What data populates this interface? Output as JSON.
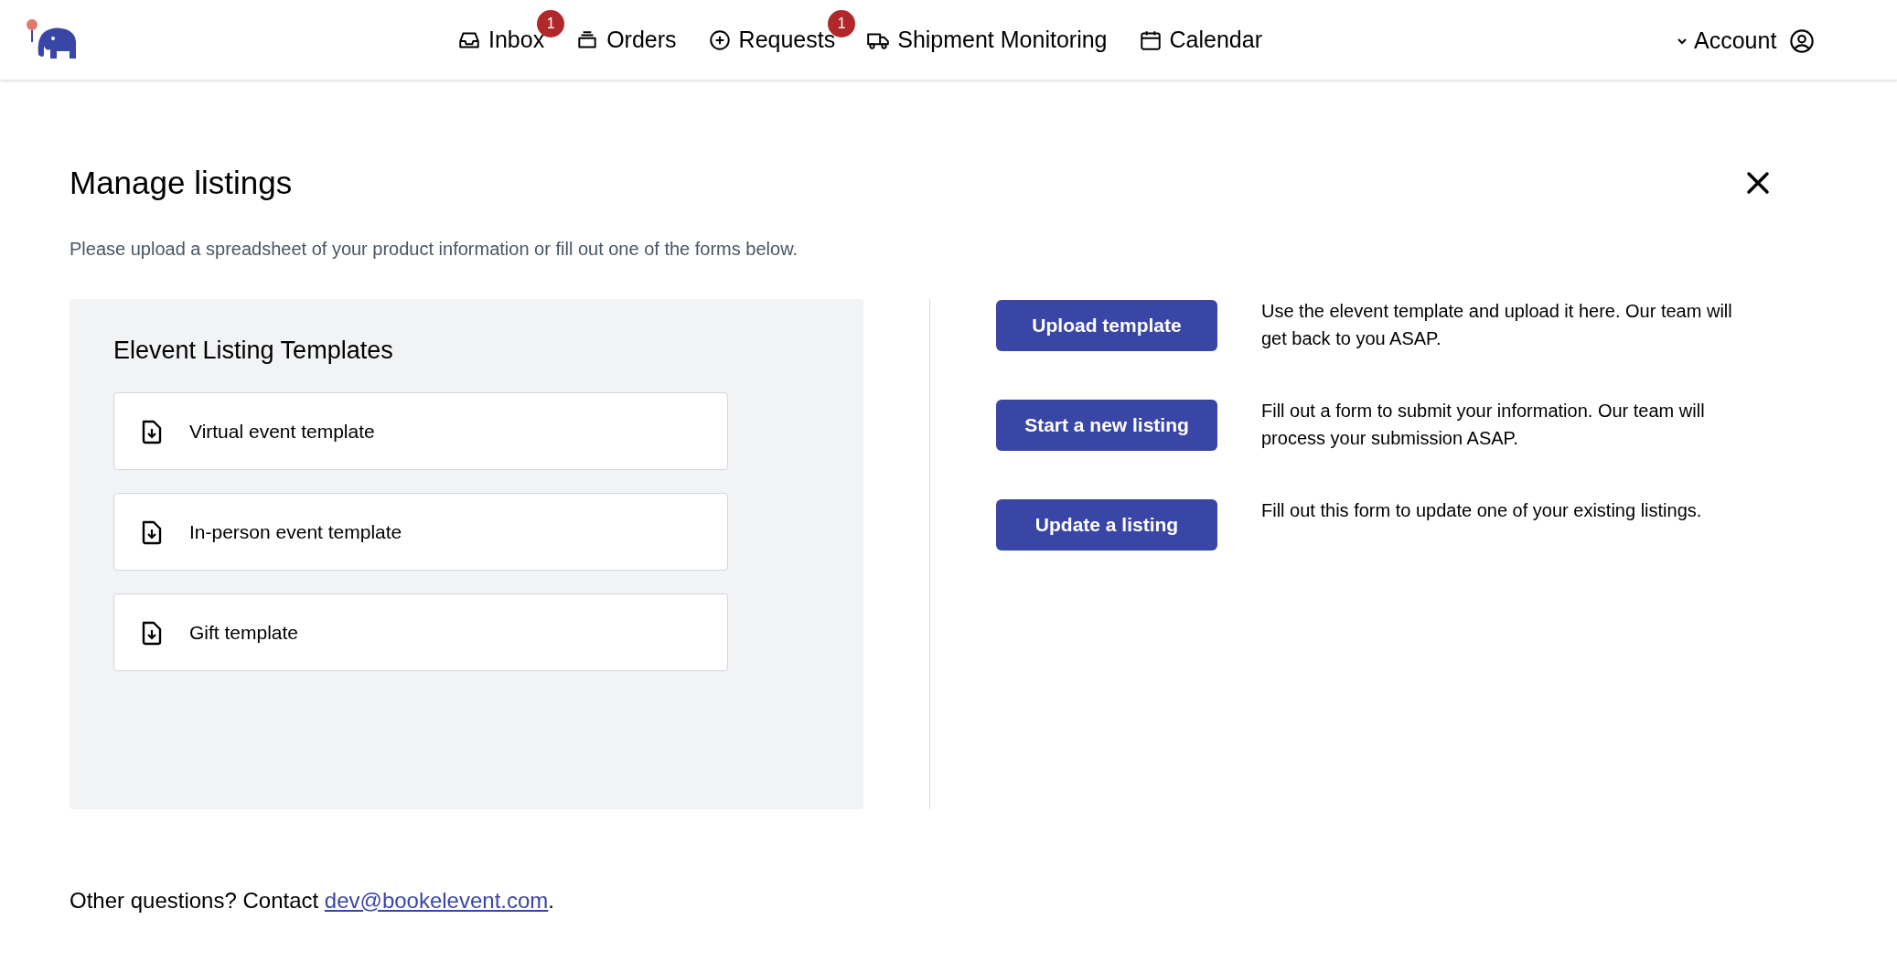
{
  "nav": [
    {
      "label": "Inbox",
      "kind": "inbox",
      "badge": "1"
    },
    {
      "label": "Orders",
      "kind": "stack"
    },
    {
      "label": "Requests",
      "kind": "plus",
      "badge": "1"
    },
    {
      "label": "Shipment Monitoring",
      "kind": "truck"
    },
    {
      "label": "Calendar",
      "kind": "calendar"
    }
  ],
  "account": {
    "label": "Account"
  },
  "page": {
    "title": "Manage listings",
    "subtitle": "Please upload a spreadsheet of your product information or fill out one of the forms below."
  },
  "templates": {
    "heading": "Elevent Listing Templates",
    "items": [
      {
        "label": "Virtual event template"
      },
      {
        "label": "In-person event template"
      },
      {
        "label": "Gift template"
      }
    ]
  },
  "actions": [
    {
      "button": "Upload template",
      "description": "Use the elevent template and upload it here. Our team will get back to you ASAP."
    },
    {
      "button": "Start a new listing",
      "description": "Fill out a form to submit your information. Our team will process your submission ASAP."
    },
    {
      "button": "Update a listing",
      "description": "Fill out this form to update one of your existing listings."
    }
  ],
  "footer": {
    "text": "Other questions? Contact ",
    "link": "dev@bookelevent.com",
    "after": "."
  }
}
